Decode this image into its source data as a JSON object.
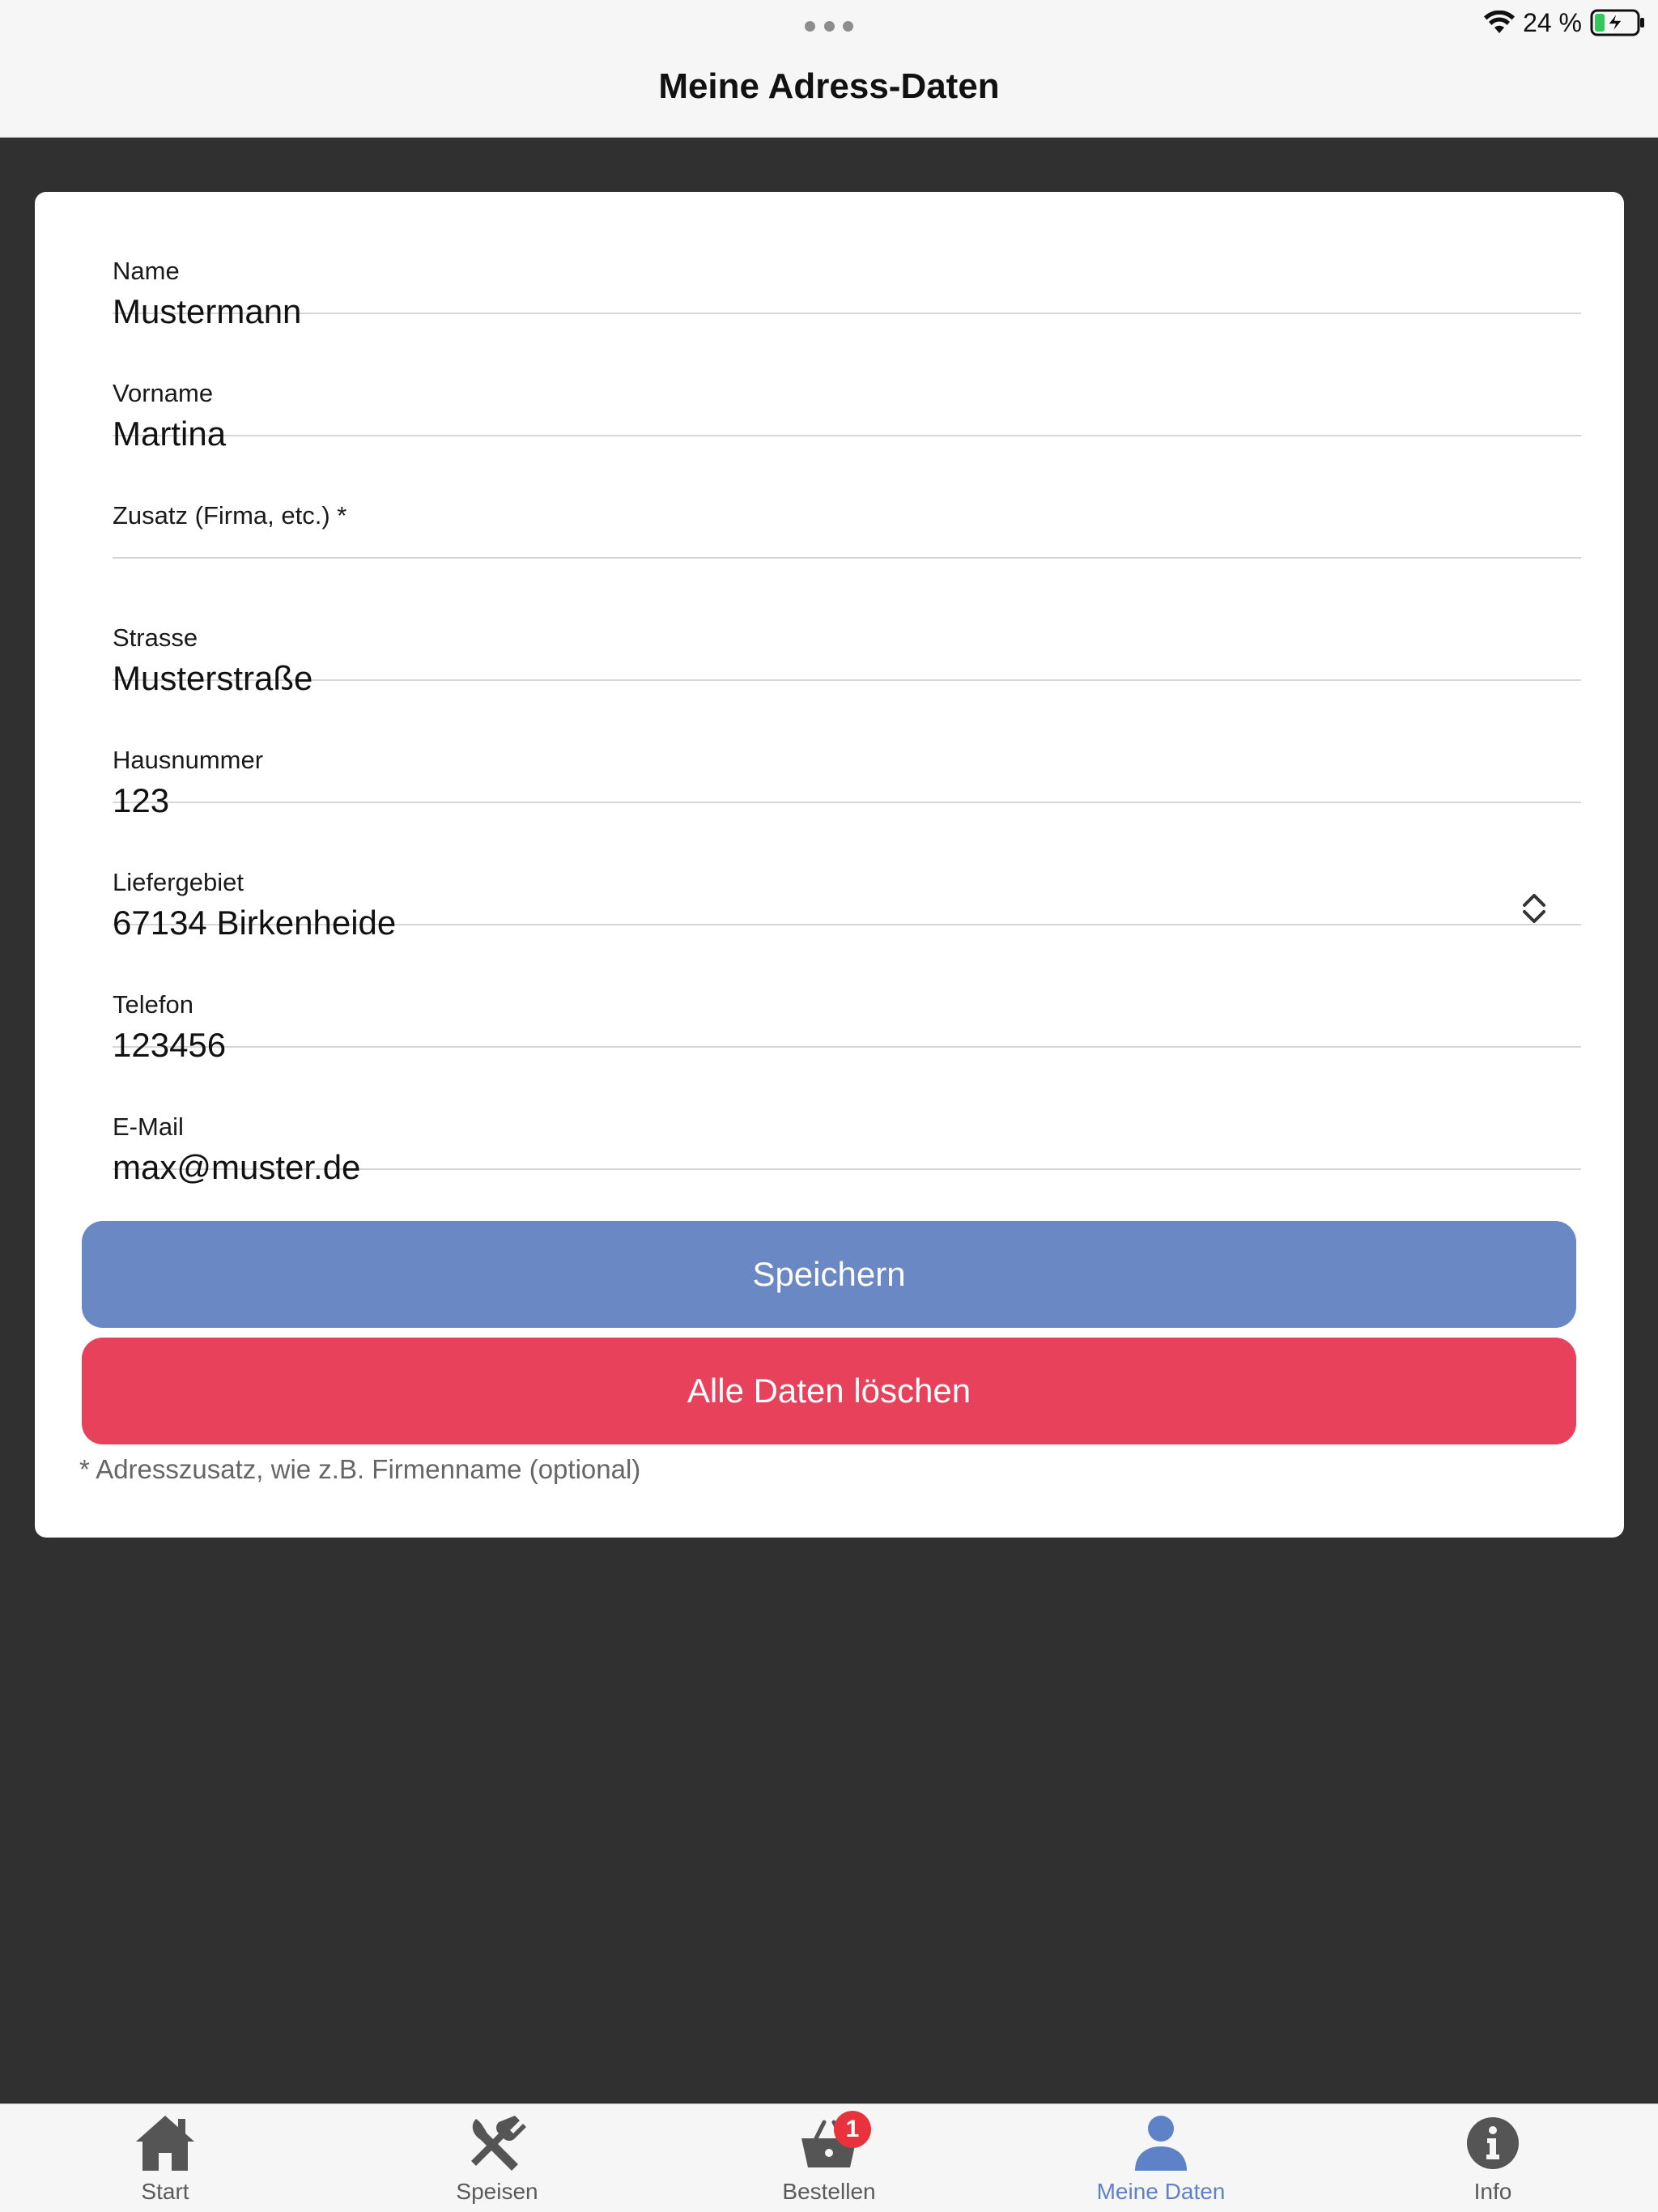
{
  "status_bar": {
    "battery_text": "24 %",
    "battery_level": 0.24
  },
  "header": {
    "title": "Meine Adress-Daten"
  },
  "form": {
    "fields": [
      {
        "id": "name",
        "label": "Name",
        "value": "Mustermann"
      },
      {
        "id": "vorname",
        "label": "Vorname",
        "value": "Martina"
      },
      {
        "id": "zusatz",
        "label": "Zusatz (Firma, etc.) *",
        "value": ""
      },
      {
        "id": "strasse",
        "label": "Strasse",
        "value": "Musterstraße"
      },
      {
        "id": "hausnummer",
        "label": "Hausnummer",
        "value": "123"
      },
      {
        "id": "liefergebiet",
        "label": "Liefergebiet",
        "value": "67134 Birkenheide"
      },
      {
        "id": "telefon",
        "label": "Telefon",
        "value": "123456"
      },
      {
        "id": "email",
        "label": "E-Mail",
        "value": "max@muster.de"
      }
    ],
    "save_label": "Speichern",
    "delete_label": "Alle Daten löschen",
    "footnote": "* Adresszusatz, wie z.B. Firmenname (optional)"
  },
  "tabbar": {
    "items": [
      {
        "label": "Start",
        "icon": "home-icon"
      },
      {
        "label": "Speisen",
        "icon": "utensils-icon"
      },
      {
        "label": "Bestellen",
        "icon": "basket-icon",
        "badge": "1"
      },
      {
        "label": "Meine Daten",
        "icon": "user-icon",
        "active": true
      },
      {
        "label": "Info",
        "icon": "info-icon"
      }
    ]
  },
  "colors": {
    "save_button": "#6a88c3",
    "delete_button": "#e8415c",
    "active_tab": "#5e82c8",
    "background": "#303030"
  }
}
